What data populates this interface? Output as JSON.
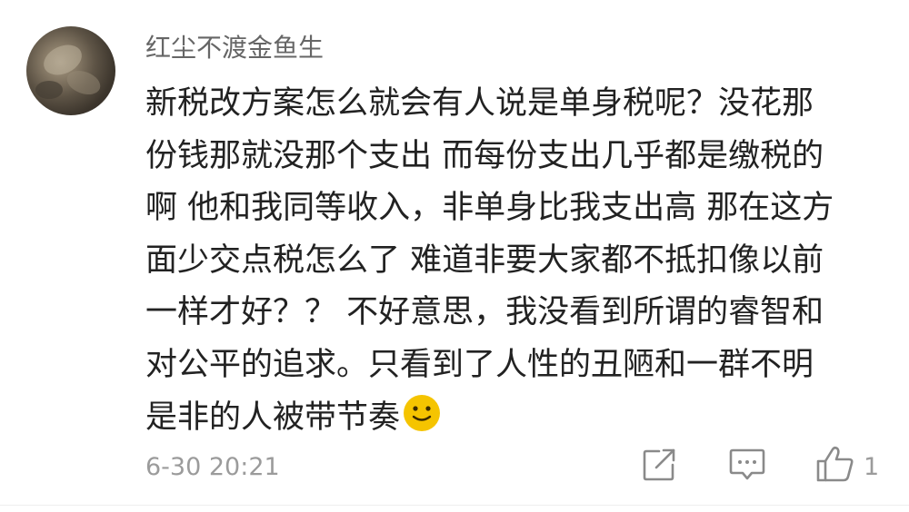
{
  "comment": {
    "username": "红尘不渡金鱼生",
    "content_lines": [
      "新税改方案怎么就会有人说是单身税呢？没花那",
      "份钱那就没那个支出 而每份支出几乎都是缴税的",
      "啊 他和我同等收入，非单身比我支出高 那在这方",
      "面少交点税怎么了 难道非要大家都不抵扣像以前",
      "一样才好？？ 不好意思，我没看到所谓的睿智和",
      "对公平的追求。只看到了人性的丑陋和一群不明",
      "是非的人被带节奏"
    ],
    "emoji": "smile-emoji",
    "timestamp": "6-30 20:21",
    "like_count": "1"
  },
  "icons": {
    "share": "share-icon",
    "reply": "reply-icon",
    "like": "thumbs-up-icon"
  },
  "colors": {
    "text": "#222222",
    "meta": "#9b9b9b",
    "username": "#666666",
    "emoji": "#f5c400"
  }
}
